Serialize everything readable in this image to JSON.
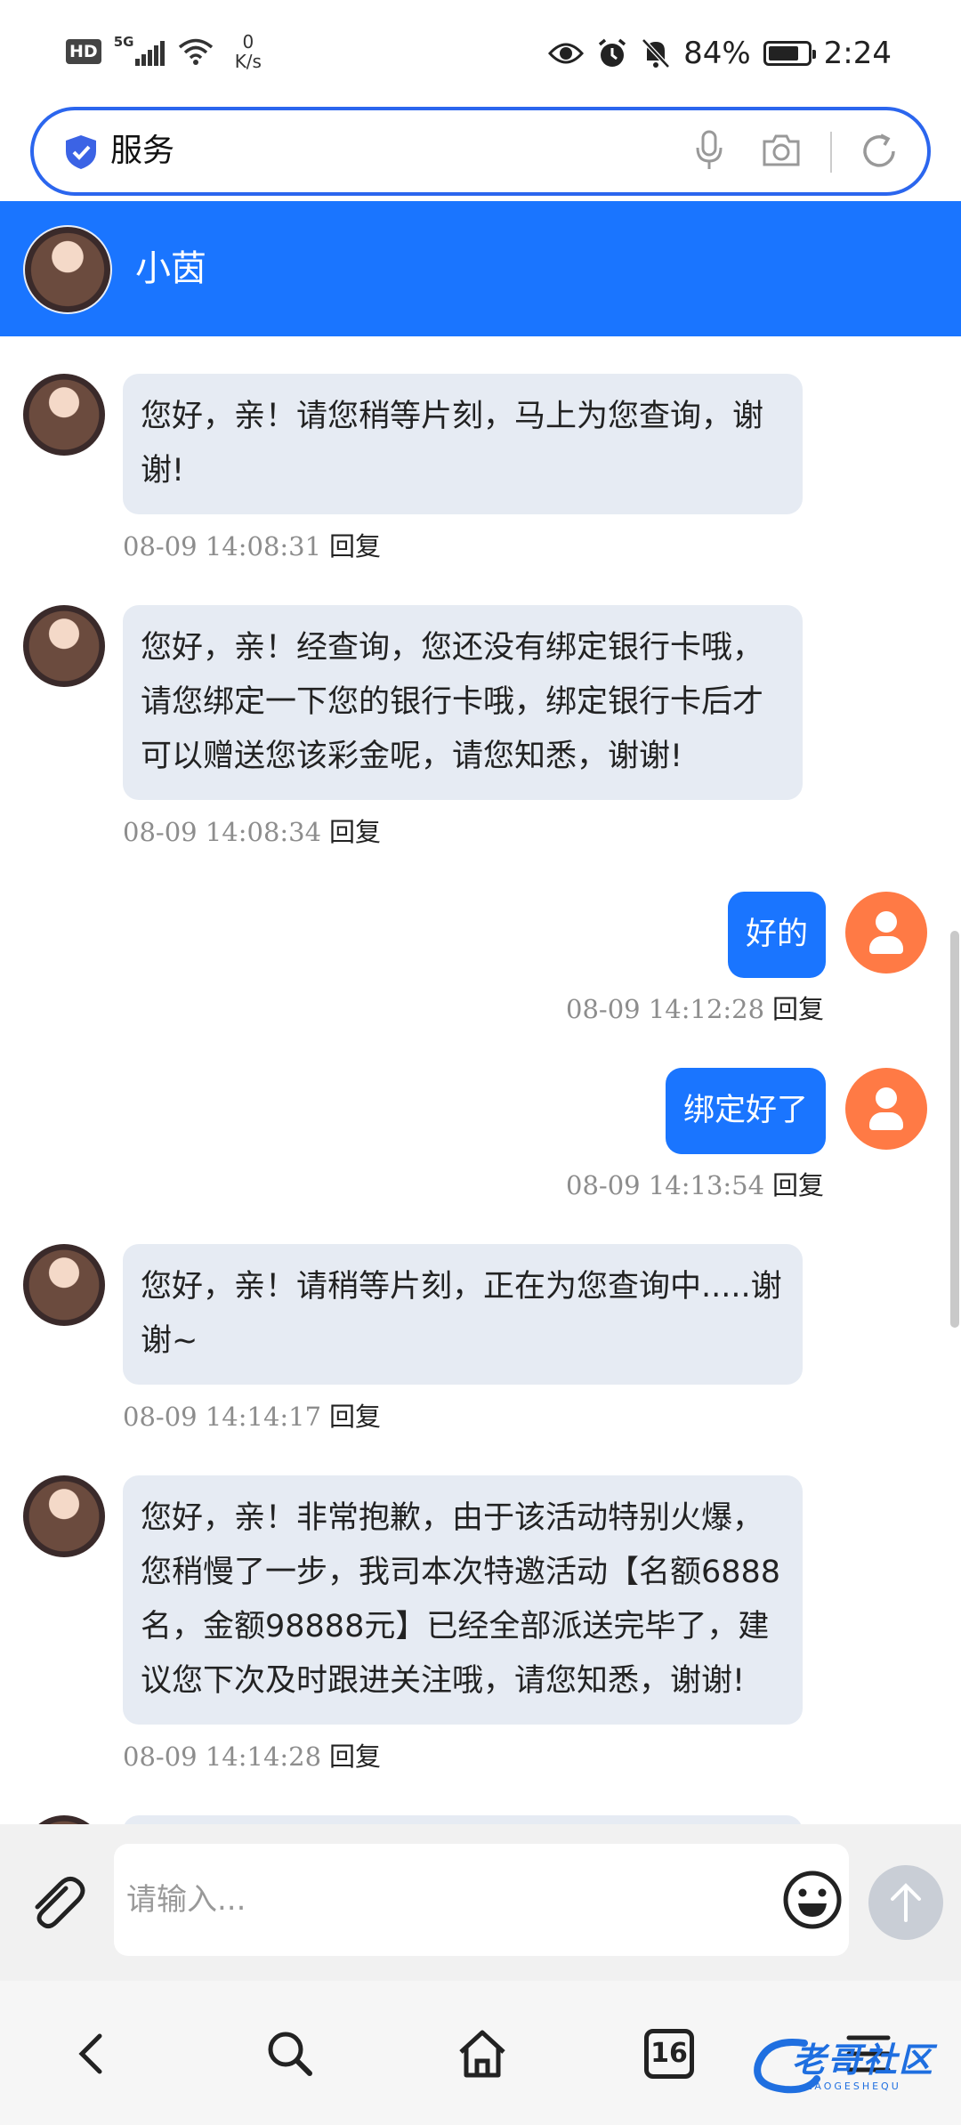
{
  "status_bar": {
    "hd": "HD",
    "network_type": "5G",
    "net_speed_value": "0",
    "net_speed_unit": "K/s",
    "battery": "84%",
    "time": "2:24"
  },
  "browser": {
    "search_text": "服务"
  },
  "chat": {
    "agent_name": "小茵",
    "reply_label": "回复",
    "messages": [
      {
        "from": "agent",
        "text": "您好，亲！请您稍等片刻，马上为您查询，谢谢!",
        "time": "08-09 14:08:31"
      },
      {
        "from": "agent",
        "text": "您好，亲！经查询，您还没有绑定银行卡哦，请您绑定一下您的银行卡哦，绑定银行卡后才可以赠送您该彩金呢，请您知悉，谢谢!",
        "time": "08-09 14:08:34"
      },
      {
        "from": "user",
        "text": "好的",
        "time": "08-09 14:12:28"
      },
      {
        "from": "user",
        "text": "绑定好了",
        "time": "08-09 14:13:54"
      },
      {
        "from": "agent",
        "text": "您好，亲！请稍等片刻，正在为您查询中.....谢谢~",
        "time": "08-09 14:14:17"
      },
      {
        "from": "agent",
        "text": "您好，亲！非常抱歉，由于该活动特别火爆，您稍慢了一步，我司本次特邀活动【名额6888名，金额98888元】已经全部派送完毕了，建议您下次及时跟进关注哦，请您知悉，谢谢!",
        "time": "08-09 14:14:28"
      }
    ]
  },
  "input": {
    "placeholder": "请输入..."
  },
  "nav": {
    "tab_count": "16"
  },
  "watermark": {
    "text": "老哥社区",
    "sub": "LAOGESHEQU"
  },
  "colors": {
    "accent": "#1a75ff",
    "search_border": "#2b66ee",
    "agent_bubble": "#e6ebf3",
    "user_avatar": "#ff7a45"
  }
}
